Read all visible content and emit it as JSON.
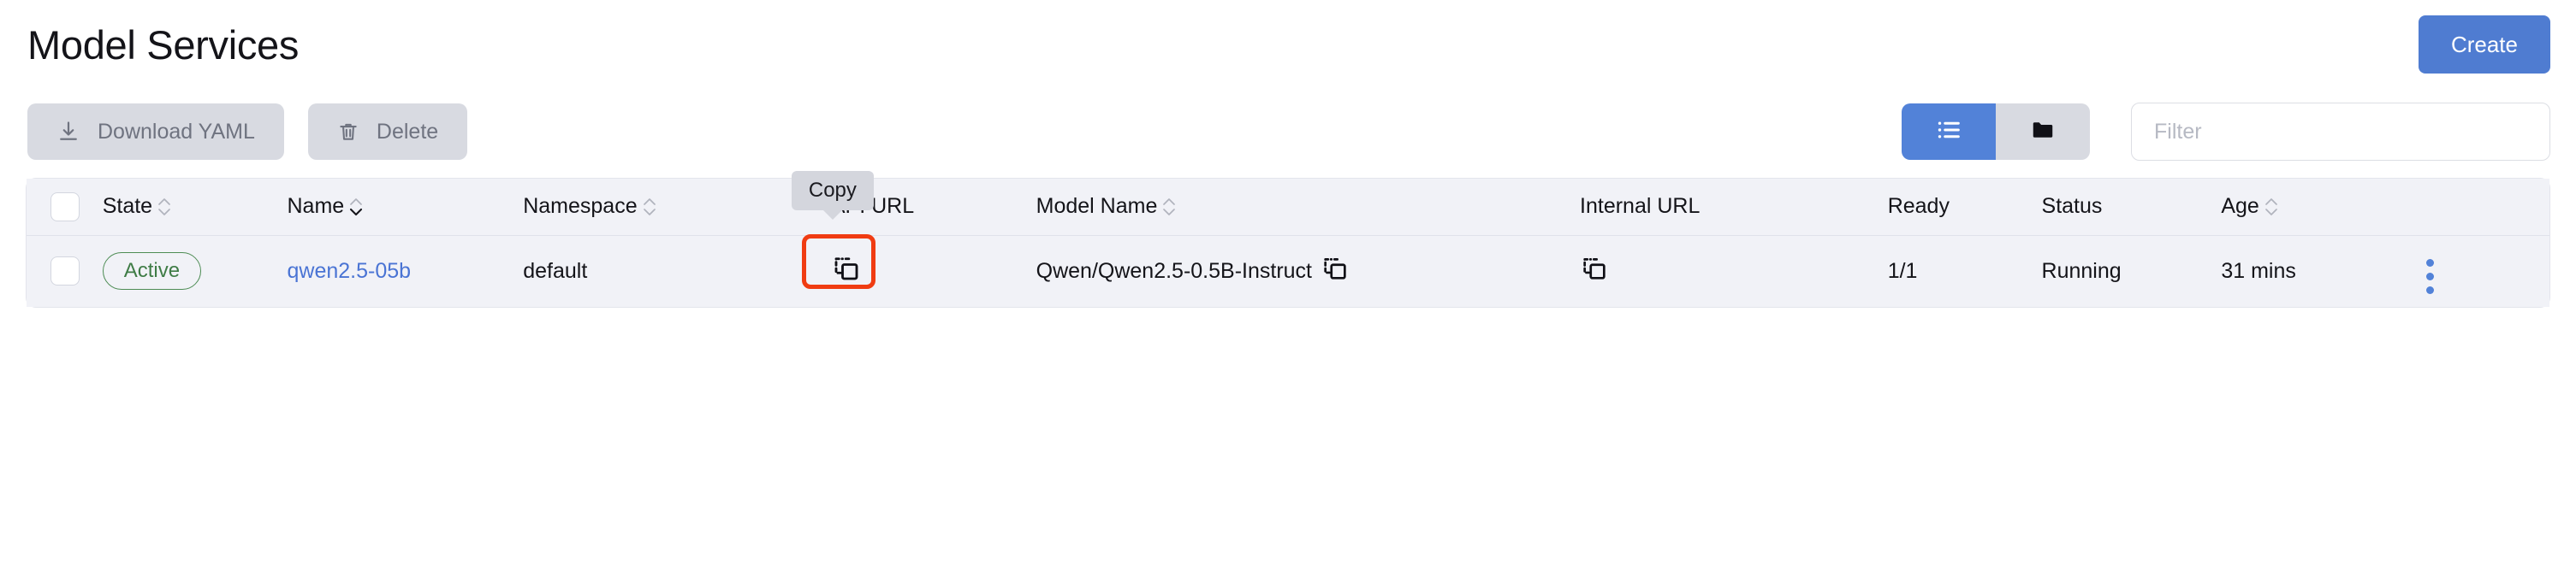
{
  "header": {
    "title": "Model Services",
    "create_label": "Create"
  },
  "toolbar": {
    "download_yaml_label": "Download YAML",
    "download_icon": "download-icon",
    "delete_label": "Delete",
    "delete_icon": "trash-icon",
    "view_list_icon": "list-view-icon",
    "view_folder_icon": "folder-view-icon",
    "active_view": "list",
    "filter_placeholder": "Filter",
    "filter_value": ""
  },
  "colors": {
    "accent_blue": "#4f7cd1",
    "toggle_active": "#5282d8",
    "button_gray": "#d8dae1",
    "table_bg": "#f1f2f7",
    "badge_green": "#3f7c46",
    "link_blue": "#4a74d4",
    "highlight_red": "#f03c12",
    "tooltip_bg": "#d4d6dd"
  },
  "table": {
    "columns": [
      {
        "key": "check",
        "label": "",
        "sortable": false,
        "sort": "none"
      },
      {
        "key": "state",
        "label": "State",
        "sortable": true,
        "sort": "none"
      },
      {
        "key": "name",
        "label": "Name",
        "sortable": true,
        "sort": "desc"
      },
      {
        "key": "ns",
        "label": "Namespace",
        "sortable": true,
        "sort": "none"
      },
      {
        "key": "api",
        "label": "API URL",
        "sortable": false,
        "sort": "none"
      },
      {
        "key": "model",
        "label": "Model Name",
        "sortable": true,
        "sort": "none"
      },
      {
        "key": "intURL",
        "label": "Internal URL",
        "sortable": false,
        "sort": "none"
      },
      {
        "key": "ready",
        "label": "Ready",
        "sortable": false,
        "sort": "none"
      },
      {
        "key": "status",
        "label": "Status",
        "sortable": false,
        "sort": "none"
      },
      {
        "key": "age",
        "label": "Age",
        "sortable": true,
        "sort": "none"
      },
      {
        "key": "menu",
        "label": "",
        "sortable": false,
        "sort": "none"
      }
    ],
    "rows": [
      {
        "selected": false,
        "state": "Active",
        "name": "qwen2.5-05b",
        "namespace": "default",
        "api_url_icon": "copy-icon",
        "model_name": "Qwen/Qwen2.5-0.5B-Instruct",
        "model_name_icon": "copy-icon",
        "internal_url_icon": "copy-icon",
        "ready": "1/1",
        "status": "Running",
        "age": "31 mins",
        "menu_icon": "kebab-menu-icon"
      }
    ]
  },
  "tooltip": {
    "label": "Copy"
  }
}
